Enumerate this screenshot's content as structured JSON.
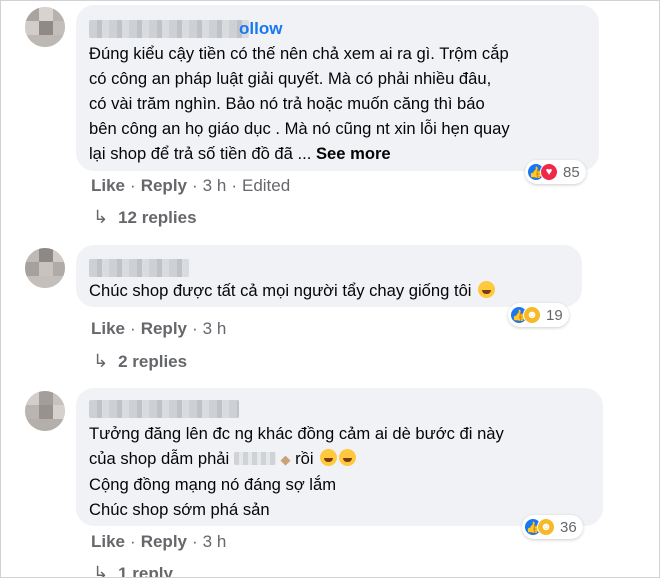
{
  "comments": [
    {
      "author_suffix": "ollow",
      "text_lines": [
        "Đúng kiểu cậy tiền có thế nên chả xem ai ra gì. Trộm cắp",
        "có công an pháp luật giải quyết. Mà có phải nhiều đâu,",
        "có vài trăm nghìn. Bảo nó trả hoặc muốn căng thì báo",
        "bên công an họ giáo dục . Mà nó cũng nt xin lỗi hẹn quay",
        "lại shop để trả số tiền đồ đã ..."
      ],
      "see_more": "See more",
      "reactions": [
        "like",
        "love"
      ],
      "reaction_count": "85",
      "like_label": "Like",
      "reply_label": "Reply",
      "time": "3 h",
      "edited": "Edited",
      "replies_label": "12 replies"
    },
    {
      "text_lines": [
        "Chúc shop được tất cả mọi người tẩy chay giống tôi"
      ],
      "reactions": [
        "like",
        "haha"
      ],
      "reaction_count": "19",
      "like_label": "Like",
      "reply_label": "Reply",
      "time": "3 h",
      "replies_label": "2 replies"
    },
    {
      "text_lines": [
        "Tưởng đăng lên đc ng khác đồng cảm ai dè bước đi này",
        "của shop dẫm phải",
        "rồi",
        "Cộng đồng mạng nó đáng sợ lắm",
        "Chúc shop sớm phá sản"
      ],
      "reactions": [
        "like",
        "haha"
      ],
      "reaction_count": "36",
      "like_label": "Like",
      "reply_label": "Reply",
      "time": "3 h",
      "replies_label": "1 reply"
    }
  ],
  "colors": {
    "bubble": "#f0f2f5",
    "link": "#1877f2",
    "meta": "#65676b"
  }
}
